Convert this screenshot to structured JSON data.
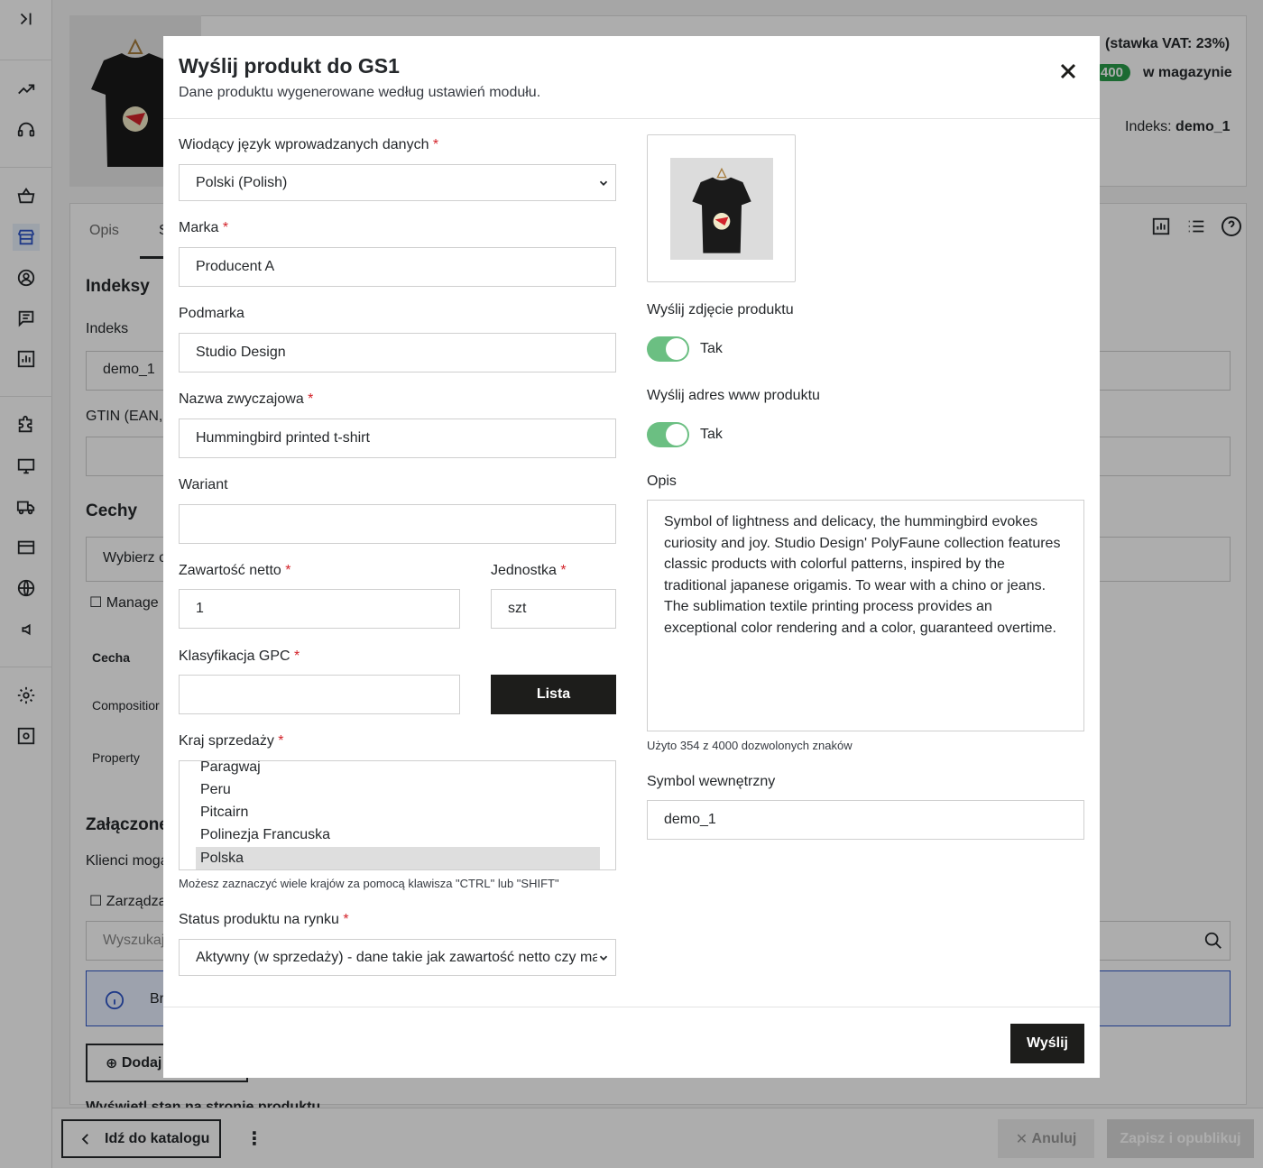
{
  "background": {
    "tabs": {
      "description": "Opis",
      "partial": "S"
    },
    "vat_text": "(stawka VAT: 23%)",
    "stock_count": "400",
    "stock_label": "w magazynie",
    "index_label": "Indeks:",
    "index_value": "demo_1",
    "section_indexes": "Indeksy",
    "index_field_label": "Indeks",
    "index_field_value": "demo_1",
    "gtin_label": "GTIN (EAN,",
    "section_features": "Cechy",
    "feature_select": "Wybierz c",
    "manage_link": "Manage",
    "feature_col": "Cecha",
    "feature_row1": "Compositior",
    "feature_row2": "Property",
    "section_attachments": "Załączone",
    "attachments_text": "Klienci moga",
    "manage_attach": "Zarządza",
    "search_placeholder": "Wyszukaj",
    "info_text": "Br",
    "add_button": "Dodaj",
    "show_stock_text": "Wyświetl stan na stronie produktu",
    "back_button": "Idź do katalogu",
    "cancel_button": "Anuluj",
    "save_button": "Zapisz i opublikuj"
  },
  "modal": {
    "title": "Wyślij produkt do GS1",
    "subtitle": "Dane produktu wygenerowane według ustawień modułu.",
    "language_label": "Wiodący język wprowadzanych danych",
    "language_value": "Polski (Polish)",
    "brand_label": "Marka",
    "brand_value": "Producent A",
    "subbrand_label": "Podmarka",
    "subbrand_value": "Studio Design",
    "common_name_label": "Nazwa zwyczajowa",
    "common_name_value": "Hummingbird printed t-shirt",
    "variant_label": "Wariant",
    "variant_value": "",
    "net_content_label": "Zawartość netto",
    "net_content_value": "1",
    "unit_label": "Jednostka",
    "unit_value": "szt",
    "gpc_label": "Klasyfikacja GPC",
    "gpc_value": "",
    "gpc_button": "Lista",
    "country_label": "Kraj sprzedaży",
    "countries": [
      "Paragwaj",
      "Peru",
      "Pitcairn",
      "Polinezja Francuska",
      "Polska"
    ],
    "country_selected": "Polska",
    "country_help": "Możesz zaznaczyć wiele krajów za pomocą klawisza \"CTRL\" lub \"SHIFT\"",
    "market_status_label": "Status produktu na rynku",
    "market_status_value": "Aktywny (w sprzedaży) - dane takie jak zawartość netto czy ma",
    "send_image_label": "Wyślij zdjęcie produktu",
    "send_image_value": "Tak",
    "send_image_on": true,
    "send_url_label": "Wyślij adres www produktu",
    "send_url_value": "Tak",
    "send_url_on": true,
    "description_label": "Opis",
    "description_value": "Symbol of lightness and delicacy, the hummingbird evokes curiosity and joy. Studio Design' PolyFaune collection features classic products with colorful patterns, inspired by the traditional japanese origamis. To wear with a chino or jeans. The sublimation textile printing process provides an exceptional color rendering and a color, guaranteed overtime.",
    "description_counter": "Użyto 354 z 4000 dozwolonych znaków",
    "internal_symbol_label": "Symbol wewnętrzny",
    "internal_symbol_value": "demo_1",
    "submit_button": "Wyślij"
  },
  "colors": {
    "toggle_on": "#6bbf82",
    "required": "#d3232a",
    "primary_dark": "#1d1d1b",
    "stock_badge": "#2a9d4b"
  }
}
